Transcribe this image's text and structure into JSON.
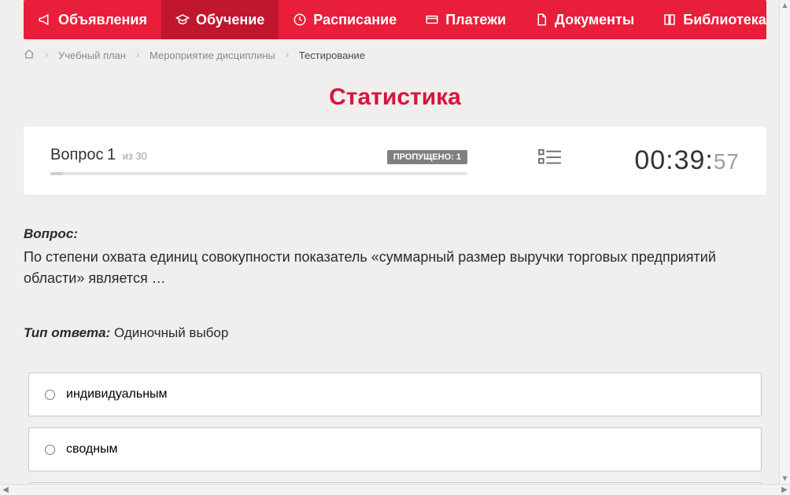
{
  "nav": {
    "items": [
      {
        "label": "Объявления",
        "icon": "megaphone-icon"
      },
      {
        "label": "Обучение",
        "icon": "graduation-icon",
        "active": true
      },
      {
        "label": "Расписание",
        "icon": "clock-icon"
      },
      {
        "label": "Платежи",
        "icon": "card-icon"
      },
      {
        "label": "Документы",
        "icon": "document-icon"
      },
      {
        "label": "Библиотека",
        "icon": "book-icon",
        "dropdown": true
      }
    ]
  },
  "breadcrumbs": {
    "items": [
      {
        "label": "Учебный план"
      },
      {
        "label": "Мероприятие дисциплины"
      }
    ],
    "current": "Тестирование"
  },
  "page_title": "Статистика",
  "status": {
    "question_word": "Вопрос",
    "question_number": "1",
    "total_prefix": "из",
    "total": "30",
    "skipped_label": "ПРОПУЩЕНО:",
    "skipped_count": "1",
    "timer_main": "00:39:",
    "timer_sec": "57"
  },
  "question": {
    "label": "Вопрос:",
    "text": "По степени охвата единиц совокупности показатель «суммарный размер выручки торговых предприятий области» является …",
    "answer_type_label": "Тип ответа:",
    "answer_type_value": "Одиночный выбор"
  },
  "answers": [
    {
      "text": "индивидуальным"
    },
    {
      "text": "сводным"
    }
  ]
}
